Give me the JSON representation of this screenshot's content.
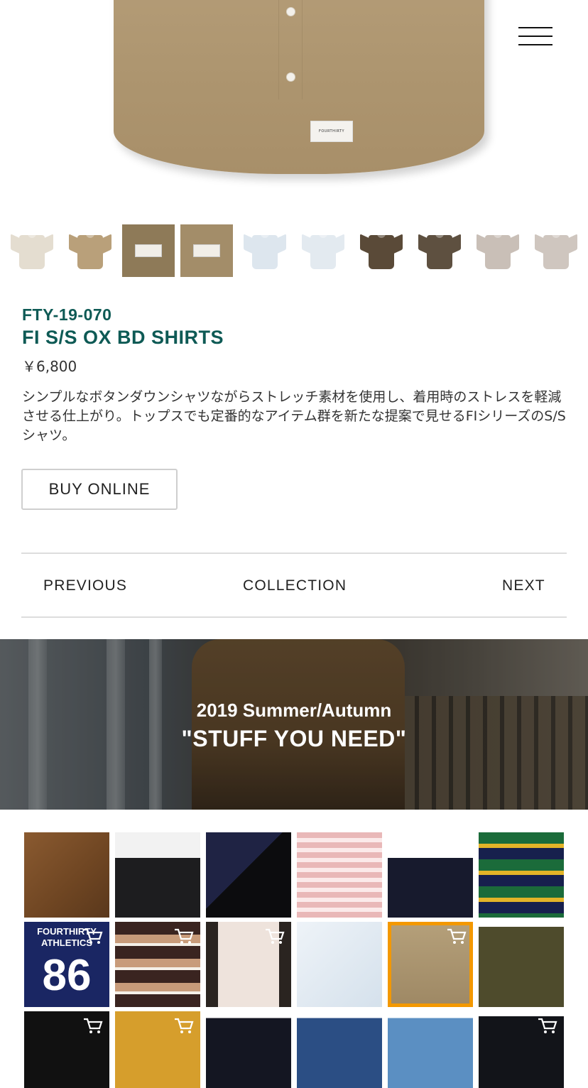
{
  "product": {
    "code": "FTY-19-070",
    "name": "FI S/S OX BD SHIRTS",
    "price": "￥6,800",
    "description": "シンプルなボタンダウンシャツながらストレッチ素材を使用し、着用時のストレスを軽減させる仕上がり。トップスでも定番的なアイテム群を新たな提案で見せるFIシリーズのS/Sシャツ。",
    "label_text": "FOURTHIRTY"
  },
  "buttons": {
    "buy_online": "BUY ONLINE"
  },
  "nav": {
    "previous": "PREVIOUS",
    "collection": "COLLECTION",
    "next": "NEXT"
  },
  "banner": {
    "season": "2019 Summer/Autumn",
    "title": "\"STUFF YOU NEED\""
  },
  "thumbnails": [
    {
      "color": "#e4ddd0"
    },
    {
      "color": "#b9a07a"
    },
    {
      "color": "#8e7a58",
      "type": "detail"
    },
    {
      "color": "#a38d69",
      "type": "detail"
    },
    {
      "color": "#dde6ee"
    },
    {
      "color": "#e3eaf0"
    },
    {
      "color": "#5a4a38"
    },
    {
      "color": "#5e5040"
    },
    {
      "color": "#c9bfb7"
    },
    {
      "color": "#cfc6bf"
    }
  ],
  "grid_text": {
    "athletics_top": "FOURTHIRTY",
    "athletics_bottom": "ATHLETICS",
    "number": "86"
  },
  "icons": {
    "menu": "hamburger-menu-icon",
    "cart": "cart-icon"
  }
}
